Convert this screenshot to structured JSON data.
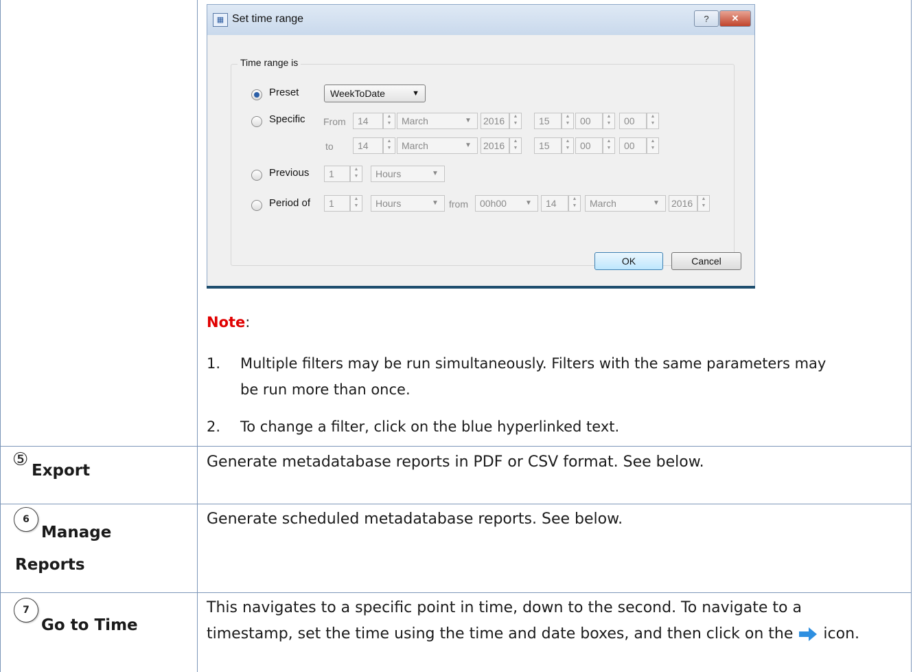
{
  "dialog": {
    "title": "Set time range",
    "help_btn": "?",
    "close_btn": "✕",
    "group_title": "Time range is",
    "preset": {
      "label": "Preset",
      "value": "WeekToDate"
    },
    "specific": {
      "label": "Specific",
      "from_label": "From",
      "to_label": "to",
      "from": {
        "day": "14",
        "month": "March",
        "year": "2016",
        "hh": "15",
        "mm": "00",
        "ss": "00"
      },
      "to": {
        "day": "14",
        "month": "March",
        "year": "2016",
        "hh": "15",
        "mm": "00",
        "ss": "00"
      }
    },
    "previous": {
      "label": "Previous",
      "count": "1",
      "unit": "Hours"
    },
    "period": {
      "label": "Period of",
      "count": "1",
      "unit": "Hours",
      "from_label": "from",
      "time": "00h00",
      "day": "14",
      "month": "March",
      "year": "2016"
    },
    "ok": "OK",
    "cancel": "Cancel"
  },
  "note": {
    "title": "Note",
    "colon": ":",
    "items": [
      {
        "num": "1.",
        "line1": "Multiple filters may be run simultaneously. Filters with the same parameters may",
        "line2": "be run more than once."
      },
      {
        "num": "2.",
        "line1": "To change a filter, click on the blue hyperlinked text."
      }
    ]
  },
  "rows": [
    {
      "num": "5",
      "label": "Export",
      "desc": "Generate metadatabase reports in PDF or CSV format. See below."
    },
    {
      "num": "6",
      "label1": "Manage",
      "label2": "Reports",
      "desc": "Generate scheduled metadatabase reports. See below."
    },
    {
      "num": "7",
      "label": "Go to Time",
      "desc1": "This navigates to a specific point in time, down to the second. To navigate to a",
      "desc2a": "timestamp, set the time using the time and date boxes, and then click on the",
      "desc2b": "icon.",
      "icon": "arrow-right-icon"
    }
  ],
  "colors": {
    "note_red": "#e00000",
    "grid_line": "#7b95b8",
    "arrow_blue": "#2e8fe0"
  }
}
